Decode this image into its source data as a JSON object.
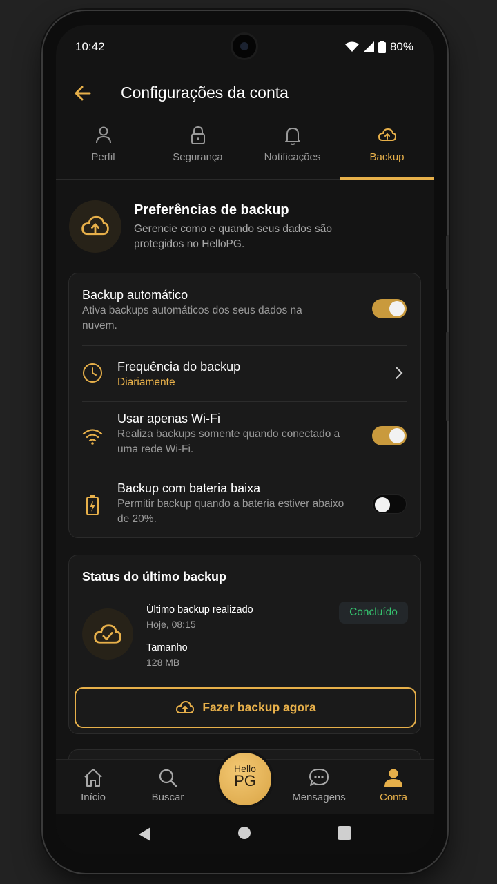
{
  "status_bar": {
    "time": "10:42",
    "battery": "80%"
  },
  "header": {
    "title": "Configurações da conta"
  },
  "tabs": [
    {
      "label": "Perfil",
      "icon": "user-icon",
      "active": false
    },
    {
      "label": "Segurança",
      "icon": "lock-icon",
      "active": false
    },
    {
      "label": "Notificações",
      "icon": "bell-icon",
      "active": false
    },
    {
      "label": "Backup",
      "icon": "cloud-upload-icon",
      "active": true
    }
  ],
  "intro": {
    "title": "Preferências de backup",
    "description": "Gerencie como e quando seus dados são protegidos no HelloPG."
  },
  "settings": {
    "auto_backup": {
      "title": "Backup automático",
      "subtitle": "Ativa backups automáticos dos seus dados na nuvem.",
      "enabled": true
    },
    "frequency": {
      "title": "Frequência do backup",
      "value": "Diariamente"
    },
    "wifi_only": {
      "title": "Usar apenas Wi-Fi",
      "subtitle": "Realiza backups somente quando conectado a uma rede Wi-Fi.",
      "enabled": true
    },
    "low_battery": {
      "title": "Backup com bateria baixa",
      "subtitle": "Permitir backup quando a bateria estiver abaixo de 20%.",
      "enabled": false
    }
  },
  "status": {
    "title": "Status do último backup",
    "last_label": "Último backup realizado",
    "last_value": "Hoje, 08:15",
    "size_label": "Tamanho",
    "size_value": "128 MB",
    "badge": "Concluído",
    "button": "Fazer backup agora"
  },
  "bottom_nav": [
    {
      "label": "Início",
      "icon": "home-icon",
      "active": false
    },
    {
      "label": "Buscar",
      "icon": "search-icon",
      "active": false
    },
    {
      "label": "Mensagens",
      "icon": "chat-icon",
      "active": false
    },
    {
      "label": "Conta",
      "icon": "account-icon",
      "active": true
    }
  ],
  "fab": {
    "line1": "Hello",
    "line2": "PG"
  },
  "colors": {
    "accent": "#e7b04a",
    "background": "#141414",
    "success": "#35c46f"
  }
}
